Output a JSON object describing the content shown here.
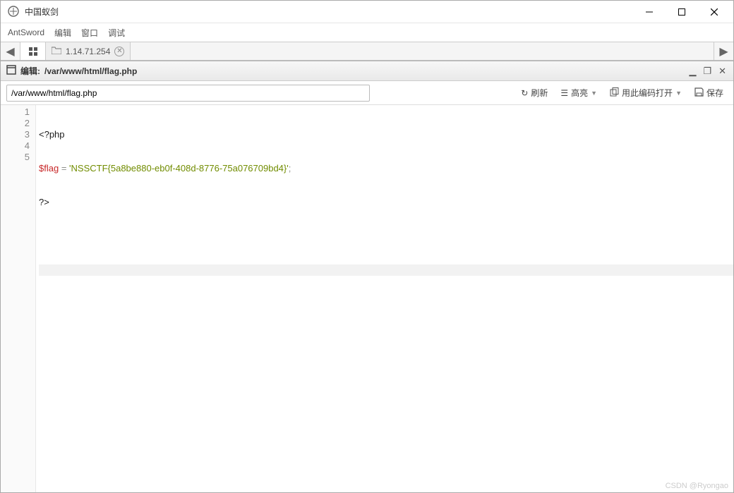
{
  "window": {
    "title": "中国蚁剑"
  },
  "menu": {
    "antsword": "AntSword",
    "edit": "编辑",
    "window": "窗口",
    "debug": "调试"
  },
  "tabs": {
    "label": "1.14.71.254"
  },
  "editHeader": {
    "prefix": "编辑: ",
    "path": "/var/www/html/flag.php"
  },
  "toolbar": {
    "path_value": "/var/www/html/flag.php",
    "refresh": "刷新",
    "highlight": "高亮",
    "openWith": "用此编码打开",
    "save": "保存"
  },
  "code": {
    "lines": [
      "1",
      "2",
      "3",
      "4",
      "5"
    ],
    "line1_xml": "<?php",
    "line2_var": "$flag",
    "line2_eq": " = ",
    "line2_str": "'NSSCTF{5a8be880-eb0f-408d-8776-75a076709bd4}'",
    "line2_semi": ";",
    "line3_xml": "?>"
  },
  "watermark": "CSDN @Ryongao"
}
